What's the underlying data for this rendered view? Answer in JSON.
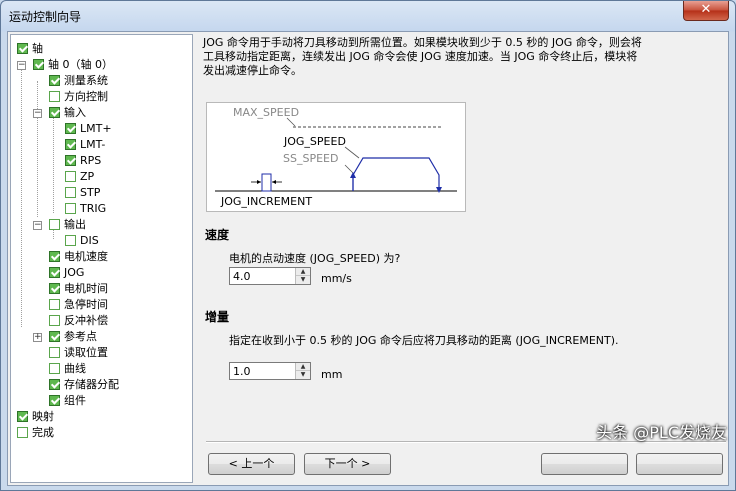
{
  "window": {
    "title": "运动控制向导",
    "close_label": "✕"
  },
  "tree": {
    "items": [
      {
        "label": "轴",
        "checked": true
      },
      {
        "label": "轴 0（轴 0）",
        "checked": true
      },
      {
        "label": "测量系统",
        "checked": true
      },
      {
        "label": "方向控制",
        "checked": false
      },
      {
        "label": "输入",
        "checked": true
      },
      {
        "label": "LMT+",
        "checked": true
      },
      {
        "label": "LMT-",
        "checked": true
      },
      {
        "label": "RPS",
        "checked": true
      },
      {
        "label": "ZP",
        "checked": false
      },
      {
        "label": "STP",
        "checked": false
      },
      {
        "label": "TRIG",
        "checked": false
      },
      {
        "label": "输出",
        "checked": false
      },
      {
        "label": "DIS",
        "checked": false
      },
      {
        "label": "电机速度",
        "checked": true
      },
      {
        "label": "JOG",
        "checked": true
      },
      {
        "label": "电机时间",
        "checked": true
      },
      {
        "label": "急停时间",
        "checked": false
      },
      {
        "label": "反冲补偿",
        "checked": false
      },
      {
        "label": "参考点",
        "checked": true
      },
      {
        "label": "读取位置",
        "checked": false
      },
      {
        "label": "曲线",
        "checked": false
      },
      {
        "label": "存储器分配",
        "checked": true
      },
      {
        "label": "组件",
        "checked": true
      },
      {
        "label": "映射",
        "checked": true
      },
      {
        "label": "完成",
        "checked": false
      }
    ],
    "expander_collapsed": "+",
    "expander_expanded": "−"
  },
  "description": "JOG 命令用于手动将刀具移动到所需位置。如果模块收到少于 0.5 秒的 JOG 命令，则会将工具移动指定距离，连续发出 JOG 命令会使 JOG 速度加速。当 JOG 命令终止后，模块将发出减速停止命令。",
  "diagram": {
    "max_speed": "MAX_SPEED",
    "jog_speed": "JOG_SPEED",
    "ss_speed": "SS_SPEED",
    "jog_increment": "JOG_INCREMENT"
  },
  "speed": {
    "title": "速度",
    "prompt": "电机的点动速度 (JOG_SPEED) 为?",
    "value": "4.0",
    "unit": "mm/s"
  },
  "increment": {
    "title": "增量",
    "prompt": "指定在收到小于 0.5 秒的 JOG 命令后应将刀具移动的距离 (JOG_INCREMENT).",
    "value": "1.0",
    "unit": "mm"
  },
  "buttons": {
    "prev": "< 上一个",
    "next": "下一个 >"
  },
  "watermark": "头条 @PLC发烧友",
  "colors": {
    "diagram_line": "#1f2ea8",
    "check_green": "#5fb84f"
  }
}
